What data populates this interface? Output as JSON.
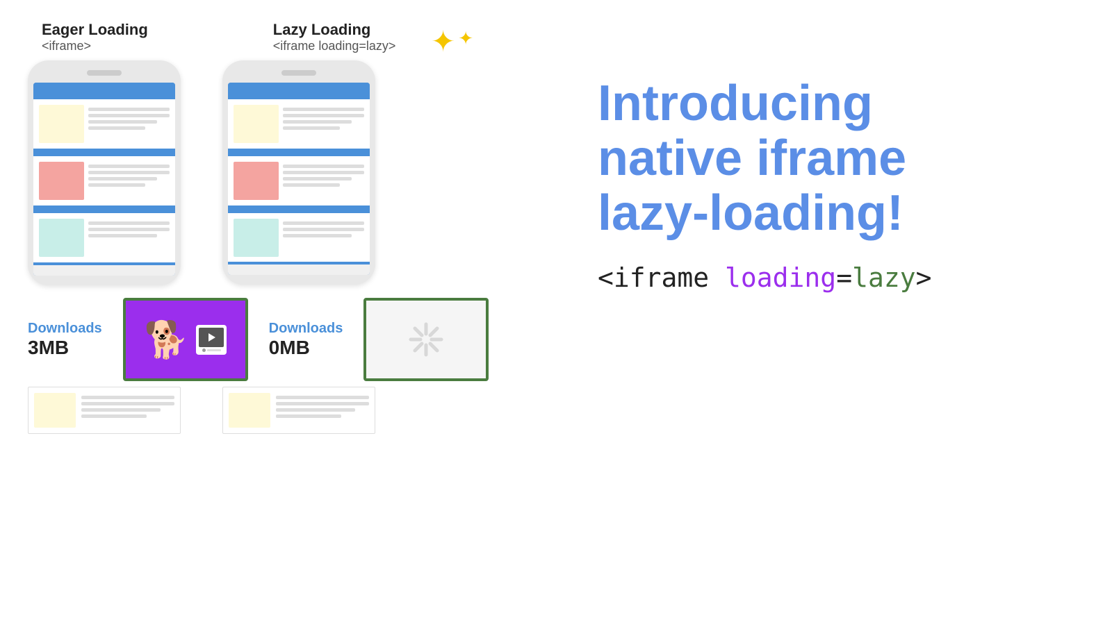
{
  "eager": {
    "title": "Eager Loading",
    "subtitle": "<iframe>"
  },
  "lazy": {
    "title": "Lazy Loading",
    "subtitle": "<iframe loading=lazy>"
  },
  "introducing": {
    "line1": "Introducing",
    "line2": "native iframe",
    "line3": "lazy-loading!"
  },
  "code_bottom": {
    "part1": "<iframe ",
    "part2": "loading",
    "part3": "=",
    "part4": "lazy",
    "part5": ">"
  },
  "downloads_eager": {
    "label": "Downloads",
    "size": "3MB"
  },
  "downloads_lazy": {
    "label": "Downloads",
    "size": "0MB"
  },
  "sparkle": "✦✦"
}
